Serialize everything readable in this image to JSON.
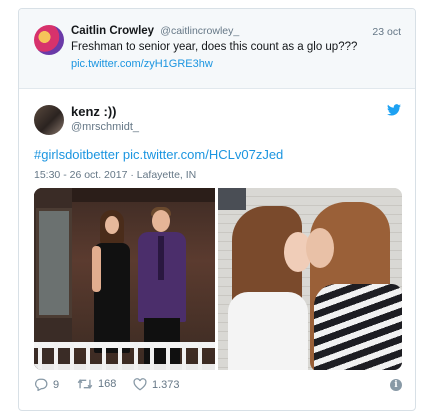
{
  "parent_tweet": {
    "name": "Caitlin Crowley",
    "handle": "@caitlincrowley_",
    "date": "23 oct",
    "text": "Freshman to senior year, does this count as a glo up???",
    "link": "pic.twitter.com/zyH1GRE3hw"
  },
  "tweet": {
    "name": "kenz :))",
    "handle": "@mrschmidt_",
    "text": "#girlsdoitbetter pic.twitter.com/HCLv07zJed",
    "meta": "15:30 - 26 oct. 2017 · Lafayette, IN"
  },
  "actions": {
    "replies": "9",
    "retweets": "168",
    "likes": "1.373"
  },
  "icons": {
    "bird": "twitter-bird-icon",
    "reply": "reply-icon",
    "retweet": "retweet-icon",
    "like": "heart-icon",
    "info": "info-icon"
  },
  "colors": {
    "link": "#1b95e0",
    "muted": "#657786",
    "bird": "#1da1f2"
  }
}
